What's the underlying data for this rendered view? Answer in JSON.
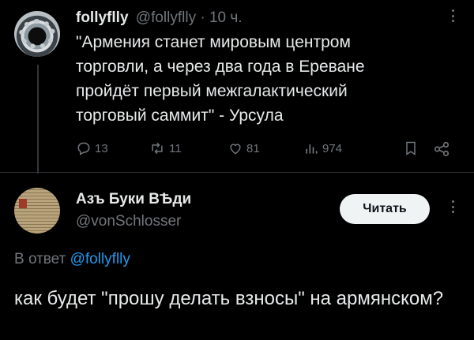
{
  "tweet1": {
    "name": "follyflly",
    "handle_time": "@follyflly · 10 ч.",
    "text": "\"Армения станет мировым центром\nторговли, а через два года в Ереване\nпройдёт первый межгалактический\nторговый саммит\" - Урсула",
    "actions": {
      "replies": "13",
      "reposts": "11",
      "likes": "81",
      "views": "974"
    }
  },
  "tweet2": {
    "name": "Азъ Буки ВѢди",
    "handle": "@vonSchlosser",
    "follow_label": "Читать",
    "reply_prefix": "В ответ",
    "reply_mention": "@follyflly",
    "text": "как будет \"прошу делать взносы\" на армянском?"
  },
  "colors": {
    "background": "#000000",
    "text": "#e7e9ea",
    "secondary": "#71767b",
    "link": "#1d9bf0",
    "button_bg": "#eff3f4"
  },
  "icons": [
    "reply-icon",
    "repost-icon",
    "like-icon",
    "views-icon",
    "bookmark-icon",
    "share-icon",
    "more-icon"
  ]
}
